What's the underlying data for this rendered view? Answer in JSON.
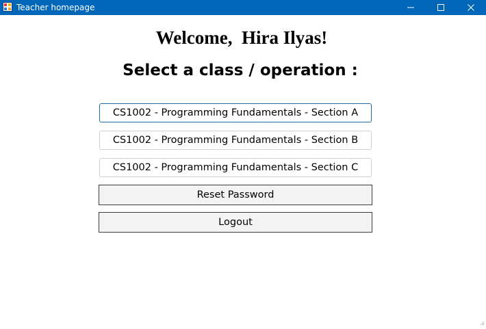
{
  "window": {
    "title": "Teacher homepage",
    "titlebar_color": "#0067b8",
    "controls": [
      "minimize-icon",
      "maximize-icon",
      "close-icon"
    ]
  },
  "welcome": {
    "text": "Welcome,  Hira Ilyas!"
  },
  "prompt": {
    "text": "Select a class / operation :"
  },
  "classes": [
    {
      "label": "CS1002 - Programming Fundamentals - Section A",
      "focused": true
    },
    {
      "label": "CS1002 - Programming Fundamentals - Section B",
      "focused": false
    },
    {
      "label": "CS1002 - Programming Fundamentals - Section C",
      "focused": false
    }
  ],
  "actions": {
    "reset_password": "Reset Password",
    "logout": "Logout"
  },
  "colors": {
    "focus_border": "#1f6aa8",
    "button_face": "#f3f3f3"
  }
}
